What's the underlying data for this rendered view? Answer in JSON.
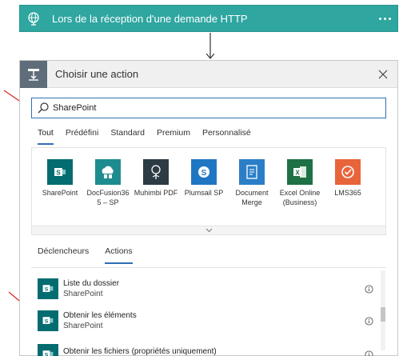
{
  "trigger": {
    "title": "Lors de la réception d'une demande HTTP",
    "icon": "globe-icon",
    "color": "#2fa6a0"
  },
  "panel": {
    "title": "Choisir une action",
    "icon": "action-icon",
    "search": {
      "value": "SharePoint",
      "placeholder": ""
    },
    "tabs": [
      {
        "label": "Tout",
        "active": true
      },
      {
        "label": "Prédéfini"
      },
      {
        "label": "Standard"
      },
      {
        "label": "Premium"
      },
      {
        "label": "Personnalisé"
      }
    ],
    "connectors": [
      {
        "label": "SharePoint",
        "icon": "sharepoint-icon",
        "color": "#036c70"
      },
      {
        "label": "DocFusion36 5 – SP",
        "icon": "docfusion-icon",
        "color": "#1e8c8f"
      },
      {
        "label": "Muhimbi PDF",
        "icon": "muhimbi-icon",
        "color": "#2d3b45"
      },
      {
        "label": "Plumsail SP",
        "icon": "plumsail-icon",
        "color": "#1f77c4"
      },
      {
        "label": "Document Merge",
        "icon": "document-merge-icon",
        "color": "#2a7ec7"
      },
      {
        "label": "Excel Online (Business)",
        "icon": "excel-icon",
        "color": "#1e7145"
      },
      {
        "label": "LMS365",
        "icon": "lms365-icon",
        "color": "#e8643a"
      }
    ],
    "subtabs": [
      {
        "label": "Déclencheurs"
      },
      {
        "label": "Actions",
        "active": true
      }
    ],
    "actions": [
      {
        "name": "Liste du dossier",
        "connector": "SharePoint"
      },
      {
        "name": "Obtenir les éléments",
        "connector": "SharePoint"
      },
      {
        "name": "Obtenir les fichiers (propriétés uniquement)",
        "connector": "SharePoint"
      }
    ]
  },
  "annotation_color": "#d9261c"
}
